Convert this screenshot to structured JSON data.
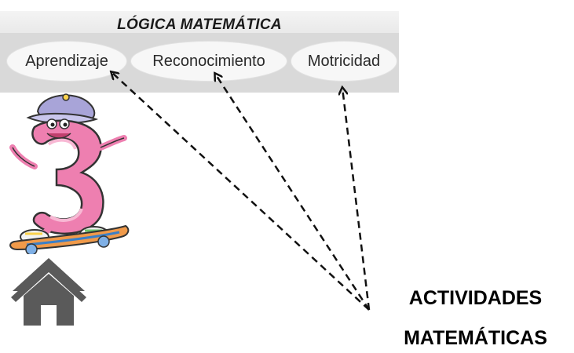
{
  "app": {
    "title": "LÓGICA MATEMÁTICA",
    "tabs": [
      {
        "label": "Aprendizaje"
      },
      {
        "label": "Reconocimiento"
      },
      {
        "label": "Motricidad"
      }
    ]
  },
  "illustration": {
    "subject": "number-three-character-on-skateboard",
    "numeral": "3"
  },
  "home": {
    "icon": "home-icon"
  },
  "annotation": {
    "line1": "ACTIVIDADES",
    "line2": "MATEMÁTICAS"
  },
  "colors": {
    "tab_bar": "#d9d9d9",
    "tab_pill": "#f7f7f7",
    "character_pink": "#ee7fb0",
    "home_icon": "#5a5a5a"
  }
}
